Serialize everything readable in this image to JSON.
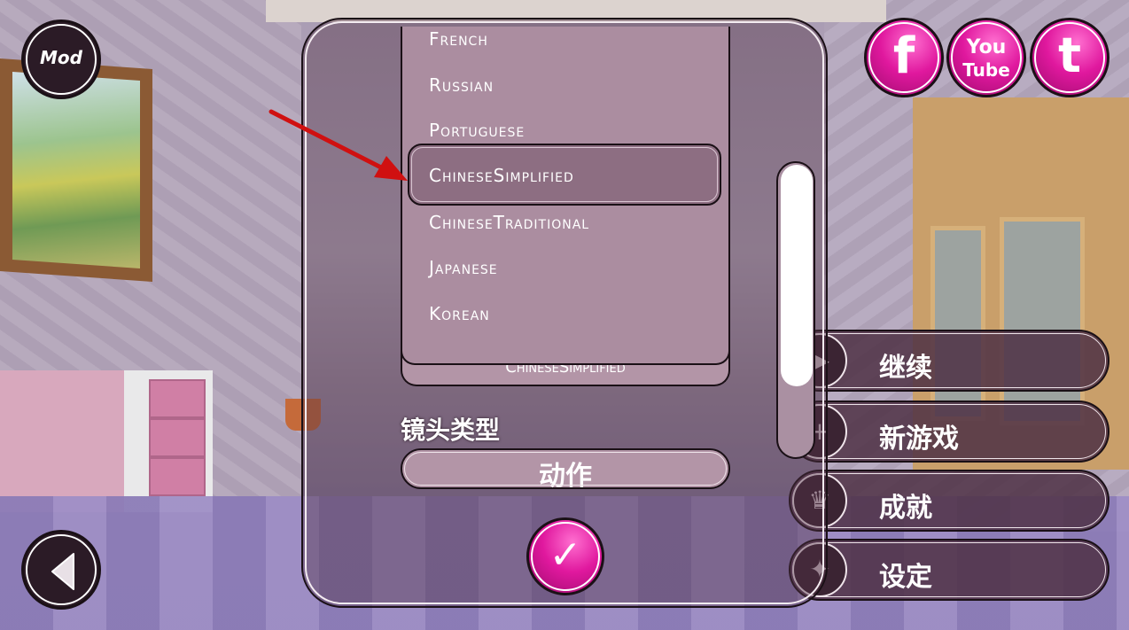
{
  "top_left": {
    "mod_label": "Mod"
  },
  "social": {
    "facebook_label": "f",
    "youtube_label_top": "You",
    "youtube_label_bottom": "Tube",
    "twitter_label": "t"
  },
  "language_dropdown": {
    "options": [
      "French",
      "Russian",
      "Portuguese",
      "ChineseSimplified",
      "ChineseTraditional",
      "Japanese",
      "Korean"
    ],
    "highlighted": "ChineseSimplified"
  },
  "language_field": {
    "value": "ChineseSimplified"
  },
  "camera": {
    "label": "镜头类型",
    "value": "动作"
  },
  "confirm": {
    "icon": "✓"
  },
  "menu": {
    "continue": "继续",
    "new_game": "新游戏",
    "achievements": "成就",
    "settings": "设定"
  },
  "colors": {
    "accent": "#e0189e",
    "highlight": "#8d6e82",
    "arrow": "#d01010"
  }
}
